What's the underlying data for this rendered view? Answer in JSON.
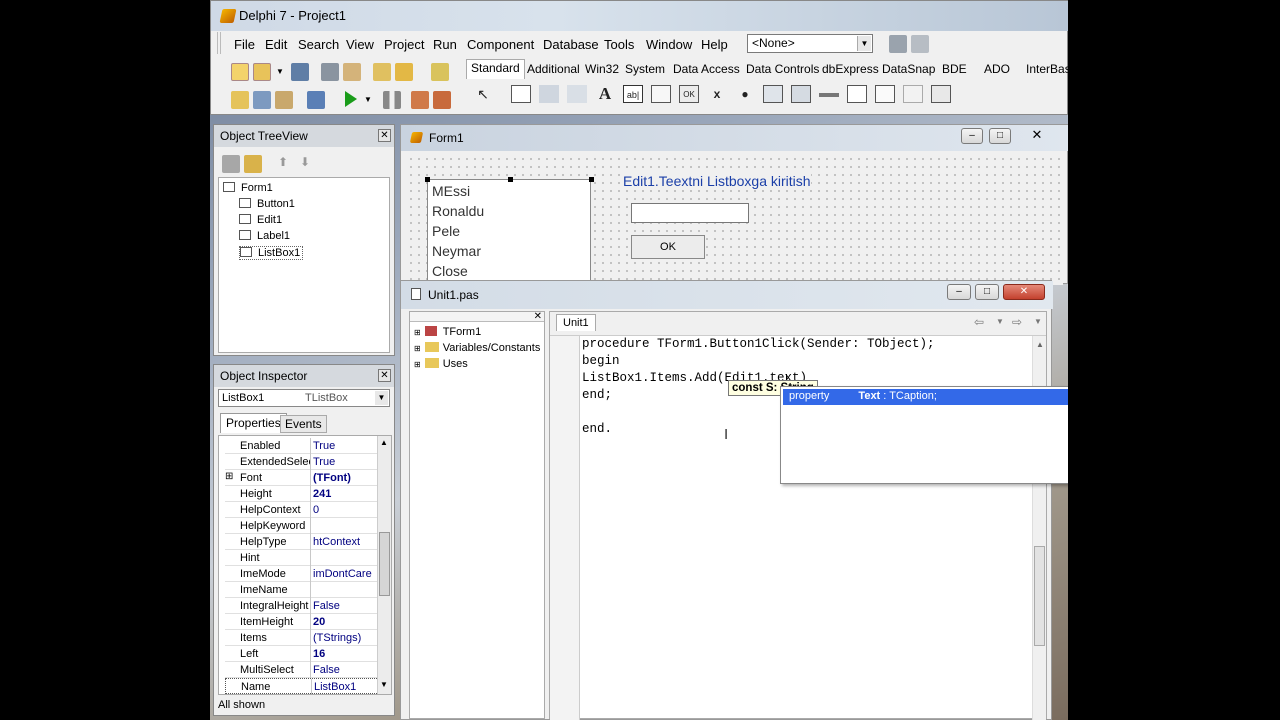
{
  "main_window": {
    "title": "Delphi 7 - Project1",
    "menus": [
      "File",
      "Edit",
      "Search",
      "View",
      "Project",
      "Run",
      "Component",
      "Database",
      "Tools",
      "Window",
      "Help"
    ],
    "combo_value": "<None>"
  },
  "palette_tabs": [
    "Standard",
    "Additional",
    "Win32",
    "System",
    "Data Access",
    "Data Controls",
    "dbExpress",
    "DataSnap",
    "BDE",
    "ADO",
    "InterBase"
  ],
  "component_icons": [
    "A",
    "ab|",
    "OK",
    "x",
    "●"
  ],
  "object_treeview": {
    "title": "Object TreeView",
    "items": [
      "Form1",
      "Button1",
      "Edit1",
      "Label1",
      "ListBox1"
    ]
  },
  "object_inspector": {
    "title": "Object Inspector",
    "selected_object": "ListBox1",
    "selected_type": "TListBox",
    "tabs": [
      "Properties",
      "Events"
    ],
    "rows": [
      {
        "k": "Enabled",
        "v": "True"
      },
      {
        "k": "ExtendedSelec",
        "v": "True"
      },
      {
        "k": "Font",
        "v": "(TFont)"
      },
      {
        "k": "Height",
        "v": "241"
      },
      {
        "k": "HelpContext",
        "v": "0"
      },
      {
        "k": "HelpKeyword",
        "v": ""
      },
      {
        "k": "HelpType",
        "v": "htContext"
      },
      {
        "k": "Hint",
        "v": ""
      },
      {
        "k": "ImeMode",
        "v": "imDontCare"
      },
      {
        "k": "ImeName",
        "v": ""
      },
      {
        "k": "IntegralHeight",
        "v": "False"
      },
      {
        "k": "ItemHeight",
        "v": "20"
      },
      {
        "k": "Items",
        "v": "(TStrings)"
      },
      {
        "k": "Left",
        "v": "16"
      },
      {
        "k": "MultiSelect",
        "v": "False"
      },
      {
        "k": "Name",
        "v": "ListBox1"
      }
    ],
    "status": "All shown",
    "font_expander": "⊞"
  },
  "form": {
    "title": "Form1",
    "listbox_items": [
      "MEssi",
      "Ronaldu",
      "Pele",
      "Neymar",
      "Close"
    ],
    "label": "Edit1.Teextni Listboxga kiritish",
    "button": "OK"
  },
  "unit_window": {
    "title": "Unit1.pas",
    "tab": "Unit1",
    "explorer": [
      "TForm1",
      "Variables/Constants",
      "Uses"
    ],
    "code": [
      "procedure TForm1.Button1Click(Sender: TObject);",
      "begin",
      "ListBox1.Items.Add(Edit1.text)",
      "end;",
      "",
      "end."
    ],
    "hint": "const S: String",
    "completion": {
      "kind": "property",
      "name": "Text",
      "type": " : TCaption;"
    }
  }
}
